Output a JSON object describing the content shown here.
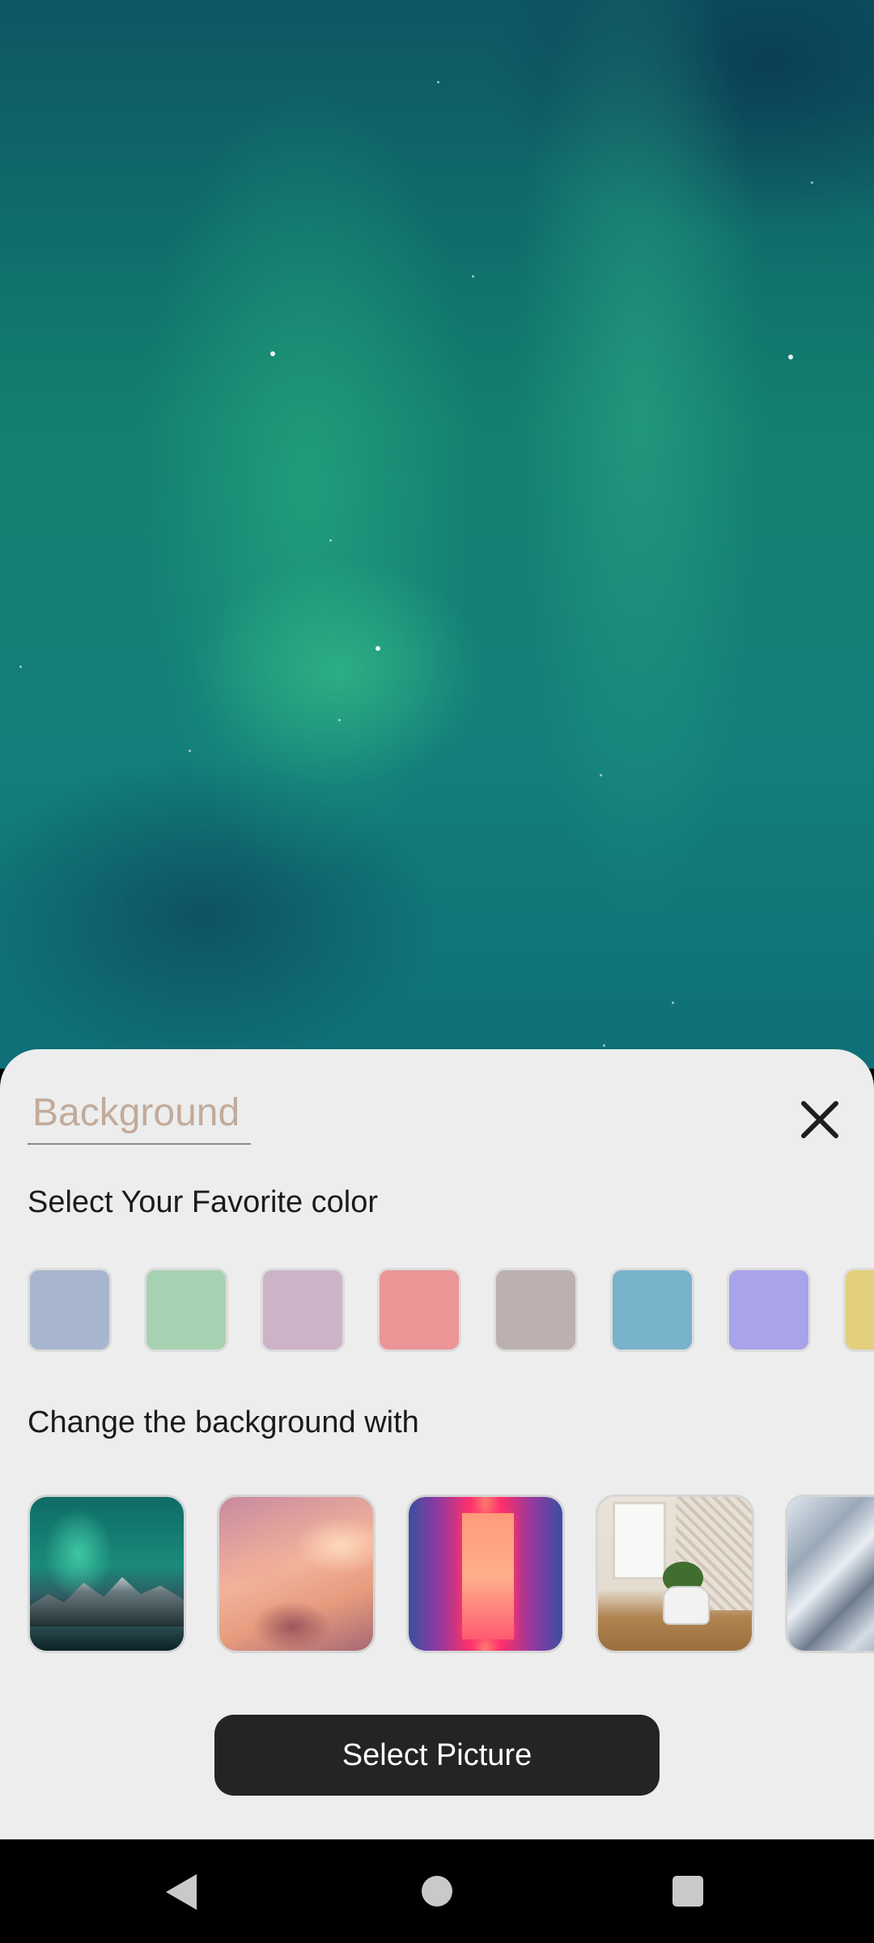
{
  "sheet": {
    "title": "Background",
    "color_section_label": "Select Your Favorite color",
    "background_section_label": "Change the background with",
    "select_button_label": "Select Picture",
    "close_icon": "close-icon"
  },
  "colors": [
    "#a7b6ce",
    "#a7d2b1",
    "#cdb3c8",
    "#eb9597",
    "#bcb0b0",
    "#79b2cb",
    "#a8a3ea",
    "#e3cf7d"
  ],
  "background_images": [
    "aurora-mountains",
    "pink-clouds",
    "neon-corridor",
    "white-room",
    "geometric-triangles"
  ],
  "wallpaper": {
    "image": "aurora-borealis"
  },
  "navbar": {
    "icons": [
      "back-icon",
      "home-icon",
      "recents-icon"
    ]
  }
}
